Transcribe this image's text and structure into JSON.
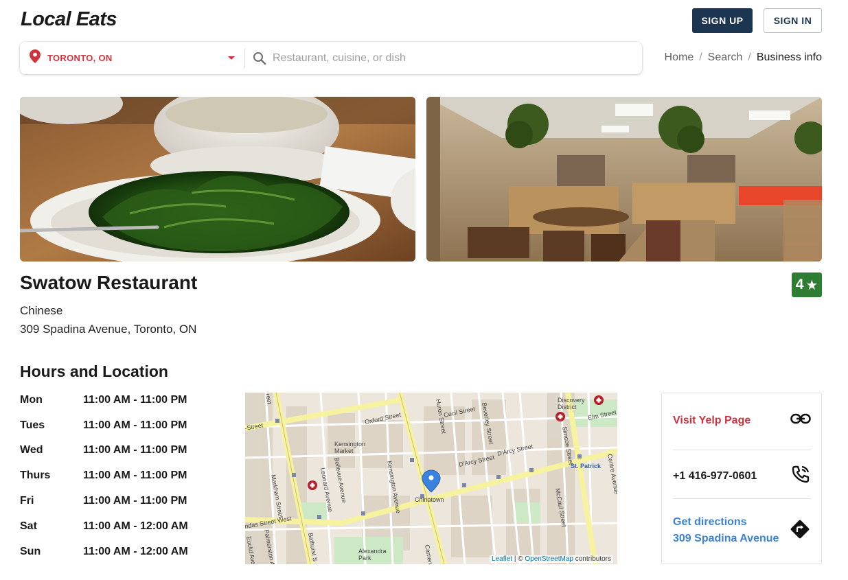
{
  "header": {
    "logo": "Local Eats",
    "signup_label": "SIGN UP",
    "signin_label": "SIGN IN"
  },
  "search": {
    "location_value": "TORONTO, ON",
    "placeholder": "Restaurant, cuisine, or dish",
    "location_icon": "map-pin-icon",
    "search_icon": "search-icon",
    "dropdown_icon": "caret-down-icon"
  },
  "breadcrumb": {
    "items": [
      "Home",
      "Search",
      "Business info"
    ],
    "separator": "/"
  },
  "business": {
    "name": "Swatow Restaurant",
    "rating": "4",
    "rating_icon": "star-icon",
    "category": "Chinese",
    "address": "309 Spadina Avenue, Toronto, ON"
  },
  "hours_section": {
    "title": "Hours and Location",
    "rows": [
      {
        "day": "Mon",
        "time": "11:00 AM - 11:00 PM"
      },
      {
        "day": "Tues",
        "time": "11:00 AM - 11:00 PM"
      },
      {
        "day": "Wed",
        "time": "11:00 AM - 11:00 PM"
      },
      {
        "day": "Thurs",
        "time": "11:00 AM - 11:00 PM"
      },
      {
        "day": "Fri",
        "time": "11:00 AM - 11:00 PM"
      },
      {
        "day": "Sat",
        "time": "11:00 AM - 12:00 AM"
      },
      {
        "day": "Sun",
        "time": "11:00 AM - 12:00 AM"
      }
    ]
  },
  "map": {
    "labels": {
      "kensington_market": "Kensington\nMarket",
      "chinatown": "Chinatown",
      "st_patrick": "St. Patrick",
      "discovery_district": "Discovery\nDistrict",
      "alexandra_park": "Alexandra\nPark",
      "oxford_street": "Oxford Street",
      "cecil_street": "Cecil Street",
      "elm_street": "Elm Street",
      "darcy_street_1": "D'Arcy Street",
      "darcy_street_2": "D'Arcy Street",
      "dundas_street_west": "ndas Street West",
      "huron_street": "Huron Street",
      "beverley_street": "Beverley Street",
      "mccaul_street": "McCaul Street",
      "simcoe_street": "Simcoe Street",
      "centre_avenue": "Centre Avenue",
      "markham_street": "Markham Street",
      "bellevue_avenue": "Bellevue Avenue",
      "leonard_avenue": "Leonard Avenue",
      "kensington_avenue": "Kensington Avenue",
      "bathurst_street": "Bathurst S",
      "cameron": "Cameron",
      "palmerston_avenue": "Palmerston Avenue",
      "euclid_avenue": "Euclid Ave",
      "street_left": "-Street",
      "reet": "reet"
    },
    "attribution_leaflet": "Leaflet",
    "attribution_sep": " | © ",
    "attribution_osm": "OpenStreetMap",
    "attribution_suffix": " contributors",
    "marker_icon": "map-marker-icon",
    "hospital_icon": "hospital-icon"
  },
  "contact": {
    "yelp_label": "Visit Yelp Page",
    "yelp_icon": "link-icon",
    "phone": "+1 416-977-0601",
    "phone_icon": "phone-icon",
    "directions_label": "Get directions",
    "directions_address": "309 Spadina Avenue",
    "directions_icon": "directions-icon"
  },
  "colors": {
    "brand_dark": "#1c3550",
    "accent_red": "#d0333e",
    "rating_green": "#2e7d32",
    "link_blue": "#3b82d6"
  }
}
